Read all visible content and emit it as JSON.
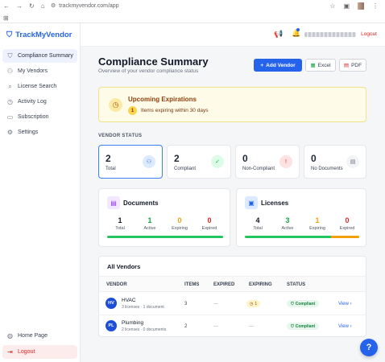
{
  "browser": {
    "url": "trackmyvendor.com/app"
  },
  "brand": {
    "name": "TrackMyVendor"
  },
  "sidebar": {
    "items": [
      {
        "label": "Compliance Summary",
        "icon": "shield-icon",
        "active": true
      },
      {
        "label": "My Vendors",
        "icon": "users-icon"
      },
      {
        "label": "License Search",
        "icon": "search-icon"
      },
      {
        "label": "Activity Log",
        "icon": "clock-icon"
      },
      {
        "label": "Subscription",
        "icon": "card-icon"
      },
      {
        "label": "Settings",
        "icon": "gear-icon"
      }
    ],
    "home_label": "Home Page",
    "logout_label": "Logout"
  },
  "header": {
    "logout_label": "Logout"
  },
  "page": {
    "title": "Compliance Summary",
    "subtitle": "Overview of your vendor compliance status",
    "add_vendor": "Add Vendor",
    "excel": "Excel",
    "pdf": "PDF"
  },
  "alert": {
    "title": "Upcoming Expirations",
    "count": "1",
    "text": "Items expiring within 30 days"
  },
  "vendor_status": {
    "label": "VENDOR STATUS",
    "stats": [
      {
        "value": "2",
        "label": "Total",
        "color": "#111827"
      },
      {
        "value": "2",
        "label": "Compliant",
        "color": "#16a34a"
      },
      {
        "value": "0",
        "label": "Non-Compliant",
        "color": "#dc2626"
      },
      {
        "value": "0",
        "label": "No Documents",
        "color": "#6b7280"
      }
    ]
  },
  "documents": {
    "title": "Documents",
    "cols": [
      {
        "value": "1",
        "label": "Total"
      },
      {
        "value": "1",
        "label": "Active"
      },
      {
        "value": "0",
        "label": "Expiring"
      },
      {
        "value": "0",
        "label": "Expired"
      }
    ],
    "active_fraction": 1.0,
    "expiring_fraction": 0.0
  },
  "licenses": {
    "title": "Licenses",
    "cols": [
      {
        "value": "4",
        "label": "Total"
      },
      {
        "value": "3",
        "label": "Active"
      },
      {
        "value": "1",
        "label": "Expiring"
      },
      {
        "value": "0",
        "label": "Expired"
      }
    ],
    "active_fraction": 0.75,
    "expiring_fraction": 0.25
  },
  "vendors": {
    "title": "All Vendors",
    "columns": [
      "VENDOR",
      "ITEMS",
      "EXPIRED",
      "EXPIRING",
      "STATUS"
    ],
    "rows": [
      {
        "initials": "HV",
        "name": "HVAC",
        "sub": "3 licenses · 1 document",
        "items": "3",
        "expired": "—",
        "expiring": "1",
        "status": "Compliant",
        "action": "View"
      },
      {
        "initials": "PL",
        "name": "Plumbing",
        "sub": "2 licenses · 0 documents",
        "items": "2",
        "expired": "—",
        "expiring": "—",
        "status": "Compliant",
        "action": "View"
      }
    ]
  },
  "help": {
    "label": "?"
  }
}
